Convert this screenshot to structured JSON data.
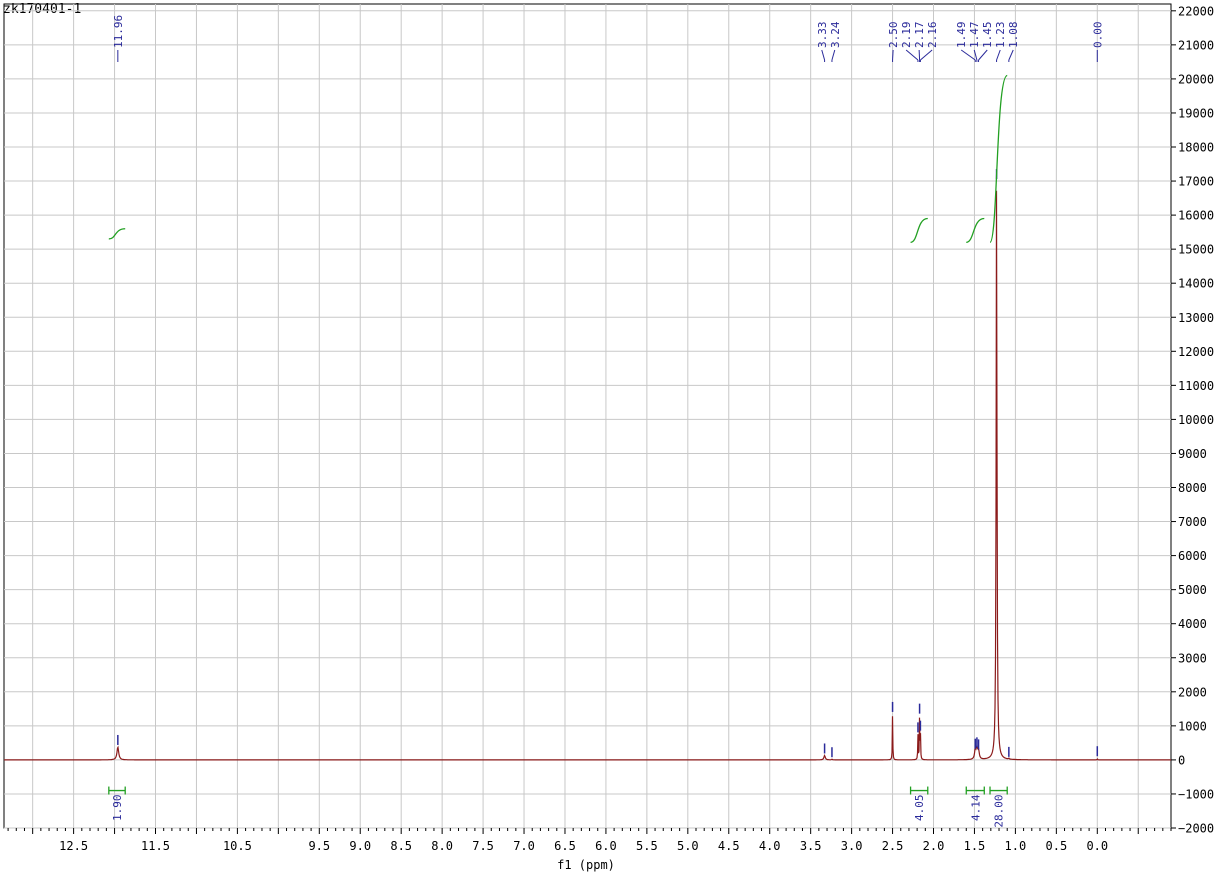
{
  "chart_data": {
    "type": "line",
    "sample_id": "zk170401-1",
    "xlabel": "f1 (ppm)",
    "ylabel": "",
    "xlim": [
      13.35,
      -0.9
    ],
    "ylim": [
      -2000,
      22200
    ],
    "x_ticks": [
      "12.5",
      "11.5",
      "10.5",
      "9.5",
      "9.0",
      "8.5",
      "8.0",
      "7.5",
      "7.0",
      "6.5",
      "6.0",
      "5.5",
      "5.0",
      "4.5",
      "4.0",
      "3.5",
      "3.0",
      "2.5",
      "2.0",
      "1.5",
      "1.0",
      "0.5",
      "0.0"
    ],
    "x_tick_values": [
      12.5,
      11.5,
      10.5,
      9.5,
      9.0,
      8.5,
      8.0,
      7.5,
      7.0,
      6.5,
      6.0,
      5.5,
      5.0,
      4.5,
      4.0,
      3.5,
      3.0,
      2.5,
      2.0,
      1.5,
      1.0,
      0.5,
      0.0
    ],
    "y_ticks": [
      22000,
      21000,
      20000,
      19000,
      18000,
      17000,
      16000,
      15000,
      14000,
      13000,
      12000,
      11000,
      10000,
      9000,
      8000,
      7000,
      6000,
      5000,
      4000,
      3000,
      2000,
      1000,
      0,
      -1000,
      -2000
    ],
    "grid": true,
    "colors": {
      "spectrum": "#8b1a1a",
      "integral": "#22a022",
      "label": "#2a2a9a",
      "grid": "#c8c8c8"
    },
    "peaks": [
      {
        "ppm": 11.96,
        "intensity": 380,
        "width": 0.025
      },
      {
        "ppm": 3.33,
        "intensity": 130,
        "width": 0.02
      },
      {
        "ppm": 3.24,
        "intensity": 20,
        "width": 0.01
      },
      {
        "ppm": 2.5,
        "intensity": 1350,
        "width": 0.006
      },
      {
        "ppm": 2.19,
        "intensity": 750,
        "width": 0.006
      },
      {
        "ppm": 2.17,
        "intensity": 1300,
        "width": 0.006
      },
      {
        "ppm": 2.16,
        "intensity": 800,
        "width": 0.006
      },
      {
        "ppm": 1.49,
        "intensity": 270,
        "width": 0.02
      },
      {
        "ppm": 1.47,
        "intensity": 310,
        "width": 0.02
      },
      {
        "ppm": 1.45,
        "intensity": 250,
        "width": 0.02
      },
      {
        "ppm": 1.23,
        "intensity": 17000,
        "width": 0.012
      },
      {
        "ppm": 1.08,
        "intensity": 30,
        "width": 0.01
      },
      {
        "ppm": 0.0,
        "intensity": 50,
        "width": 0.005
      }
    ],
    "peak_labels": [
      {
        "group": [
          "11.96"
        ],
        "ppm": [
          11.96
        ]
      },
      {
        "group": [
          "3.33",
          "3.24"
        ],
        "ppm": [
          3.33,
          3.24
        ]
      },
      {
        "group": [
          "2.50",
          "2.19",
          "2.17",
          "2.16"
        ],
        "ppm": [
          2.5,
          2.19,
          2.17,
          2.16
        ]
      },
      {
        "group": [
          "1.49",
          "1.47",
          "1.45",
          "1.23",
          "1.08"
        ],
        "ppm": [
          1.49,
          1.47,
          1.45,
          1.23,
          1.08
        ]
      },
      {
        "group": [
          "0.00"
        ],
        "ppm": [
          0.0
        ]
      }
    ],
    "integrals": [
      {
        "value": "1.90",
        "from": 12.07,
        "to": 11.87,
        "curve_base": 15300,
        "curve_top": 15600
      },
      {
        "value": "4.05",
        "from": 2.28,
        "to": 2.07,
        "curve_base": 15200,
        "curve_top": 15900
      },
      {
        "value": "4.14",
        "from": 1.6,
        "to": 1.38,
        "curve_base": 15200,
        "curve_top": 15900
      },
      {
        "value": "28.00",
        "from": 1.31,
        "to": 1.1,
        "curve_base": 15200,
        "curve_top": 20100
      }
    ]
  }
}
